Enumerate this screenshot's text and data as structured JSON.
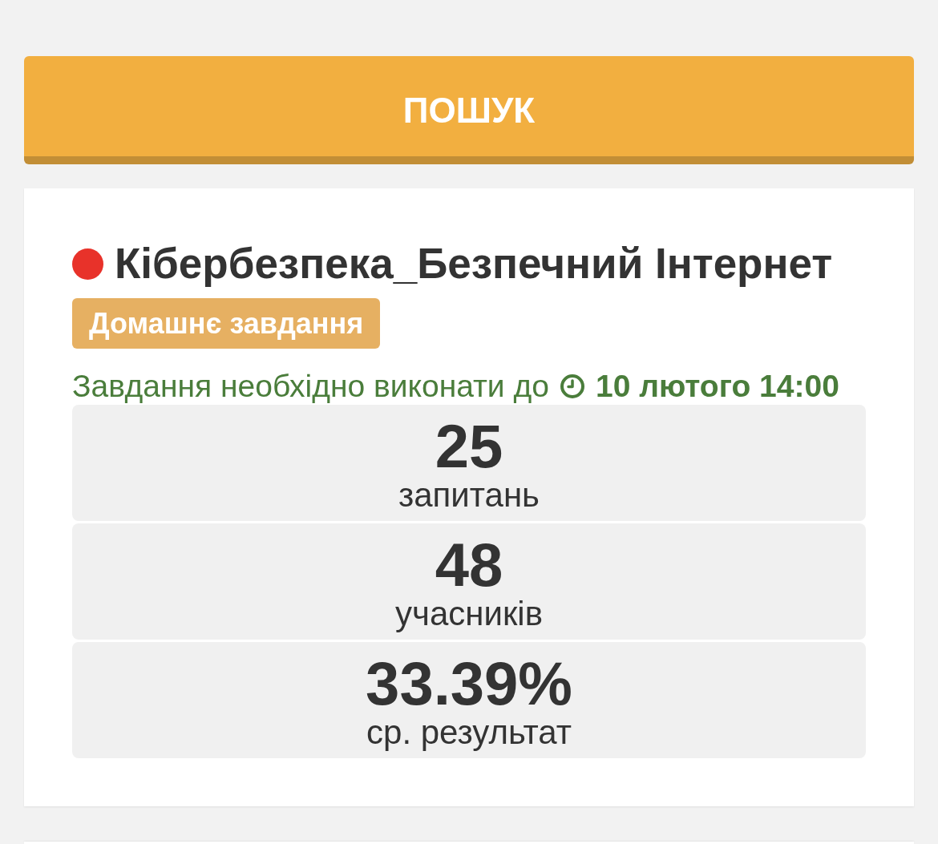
{
  "search_button": {
    "label": "ПОШУК"
  },
  "assignment": {
    "color": "#e8322a",
    "title": "Кібербезпека_Безпечний Інтернет",
    "badge": "Домашнє завдання",
    "due_label": "Завдання необхідно виконати до",
    "due_date": "10 лютого 14:00",
    "stats": [
      {
        "value": "25",
        "label": "запитань"
      },
      {
        "value": "48",
        "label": "учасників"
      },
      {
        "value": "33.39%",
        "label": "ср. результат"
      }
    ]
  }
}
